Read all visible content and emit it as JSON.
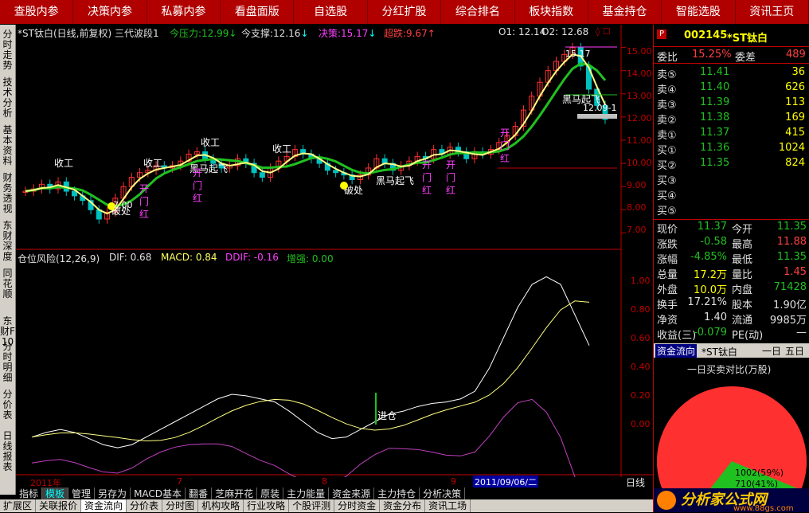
{
  "top_menu": [
    "查股内参",
    "决策内参",
    "私募内参",
    "看盘面版",
    "自选股",
    "分红扩股",
    "综合排名",
    "板块指数",
    "基金持仓",
    "智能选股",
    "资讯王页"
  ],
  "left_nav": [
    "分时走势",
    "技术分析",
    "基本资料",
    "财务透视",
    "东财深度",
    "同花顺",
    "东财F10",
    "分时明细",
    "分价表",
    "日线报表"
  ],
  "chart": {
    "header": "*ST钛白(日线,前复权) 三代波段1",
    "today_pressure_label": "今压力:",
    "today_pressure": "12.99",
    "today_support_label": "今支撑:",
    "today_support": "12.16",
    "decision_label": "决策:",
    "decision": "15.17",
    "overbought_label": "超跌:",
    "overbought": "9.67",
    "o1": "O1: 12.14",
    "o2": "O2: 12.68",
    "high_label": "15.17",
    "low_label": "7.00",
    "right_price_label": "12.09-1",
    "annotations": [
      "收工",
      "收工",
      "收工",
      "收工",
      "黑马起飞",
      "黑马起飞",
      "黑马起飞",
      "破处",
      "破处",
      "开门红",
      "开门红",
      "开门红",
      "开门红",
      "开门红"
    ],
    "price_ticks": [
      "15.00",
      "14.00",
      "13.00",
      "12.00",
      "11.00",
      "10.00",
      "9.00",
      "8.00",
      "7.00"
    ],
    "indicator_header": "仓位风险(12,26,9)",
    "dif": "DIF: 0.68",
    "macd": "MACD: 0.84",
    "ddif": "DDIF: -0.16",
    "zengqiang": "增强: 0.00",
    "indicator_ticks": [
      "1.00",
      "0.80",
      "0.60",
      "0.40",
      "0.20",
      "0.00"
    ],
    "enter_label": "进仓",
    "date_labels": [
      "2011年",
      "7",
      "8",
      "9"
    ],
    "date_cursor": "2011/09/06/二",
    "right_corner": "日线"
  },
  "chart_data": {
    "type": "candlestick",
    "title": "*ST钛白(日线,前复权) 三代波段1",
    "x": [
      "2011年",
      "7",
      "8",
      "9"
    ],
    "ylim": [
      6.5,
      15.5
    ],
    "closes": [
      8.8,
      8.9,
      9.1,
      8.9,
      9.2,
      8.8,
      8.6,
      8.4,
      8.0,
      7.6,
      7.9,
      8.5,
      9.0,
      9.4,
      9.6,
      9.7,
      9.9,
      9.8,
      9.9,
      10.1,
      10.4,
      10.5,
      10.2,
      10.0,
      9.8,
      9.9,
      10.2,
      10.0,
      9.6,
      9.4,
      9.8,
      10.1,
      10.3,
      10.6,
      10.4,
      10.2,
      10.0,
      9.7,
      9.6,
      9.5,
      9.3,
      9.5,
      9.8,
      10.2,
      10.0,
      9.7,
      9.9,
      10.1,
      10.3,
      10.2,
      10.6,
      10.4,
      10.7,
      10.5,
      10.2,
      10.5,
      10.4,
      10.6,
      10.9,
      11.2,
      11.6,
      12.3,
      12.9,
      13.5,
      14.0,
      14.4,
      14.7,
      15.0,
      14.2,
      13.2,
      12.5,
      11.9
    ]
  },
  "right_panel": {
    "stock_code": "002145",
    "stock_name": "*ST钛白",
    "weibi_label": "委比",
    "weibi": "15.25%",
    "weicha_label": "委差",
    "weicha": "489",
    "sells": [
      {
        "label": "卖⑤",
        "price": "11.41",
        "vol": "36"
      },
      {
        "label": "卖④",
        "price": "11.40",
        "vol": "626"
      },
      {
        "label": "卖③",
        "price": "11.39",
        "vol": "113"
      },
      {
        "label": "卖②",
        "price": "11.38",
        "vol": "169"
      },
      {
        "label": "卖①",
        "price": "11.37",
        "vol": "415"
      }
    ],
    "buys": [
      {
        "label": "买①",
        "price": "11.36",
        "vol": "1024"
      },
      {
        "label": "买②",
        "price": "11.35",
        "vol": "824"
      },
      {
        "label": "买③",
        "price": "",
        "vol": ""
      },
      {
        "label": "买④",
        "price": "",
        "vol": ""
      },
      {
        "label": "买⑤",
        "price": "",
        "vol": ""
      }
    ],
    "stats": [
      {
        "l1": "现价",
        "v1": "11.37",
        "l2": "今开",
        "v2": "11.35"
      },
      {
        "l1": "涨跌",
        "v1": "-0.58",
        "l2": "最高",
        "v2": "11.88"
      },
      {
        "l1": "涨幅",
        "v1": "-4.85%",
        "l2": "最低",
        "v2": "11.35"
      },
      {
        "l1": "总量",
        "v1": "17.2万",
        "l2": "量比",
        "v2": "1.45"
      },
      {
        "l1": "外盘",
        "v1": "10.0万",
        "l2": "内盘",
        "v2": "71428"
      },
      {
        "l1": "换手",
        "v1": "17.21%",
        "l2": "股本",
        "v2": "1.90亿"
      },
      {
        "l1": "净资",
        "v1": "1.40",
        "l2": "流通",
        "v2": "9985万"
      },
      {
        "l1": "收益(三)",
        "v1": "-0.079",
        "l2": "PE(动)",
        "v2": "—"
      }
    ],
    "fund_flow_label": "资金流向",
    "fund_flow_name": "*ST钛白",
    "one_day": "一日",
    "five_day": "五日",
    "pie_title": "一日买卖对比(万股)",
    "pie_buy": "1002(59%)",
    "pie_sell": "710(41%)",
    "logo": "分析家公式网",
    "logo_url": "www.88gs.com"
  },
  "bottom_tabs": [
    "指标",
    "模板",
    "管理",
    "另存为",
    "MACD基本",
    "翻番",
    "芝麻开花",
    "原装",
    "主力能量",
    "资金来源",
    "主力持仓",
    "分析决策"
  ],
  "bottom_tabs2": [
    "扩展区",
    "关联报价",
    "资金流向",
    "分价表",
    "分时图",
    "机构攻略",
    "行业攻略",
    "个股评测",
    "分时资金",
    "资金分布",
    "资讯工场"
  ]
}
